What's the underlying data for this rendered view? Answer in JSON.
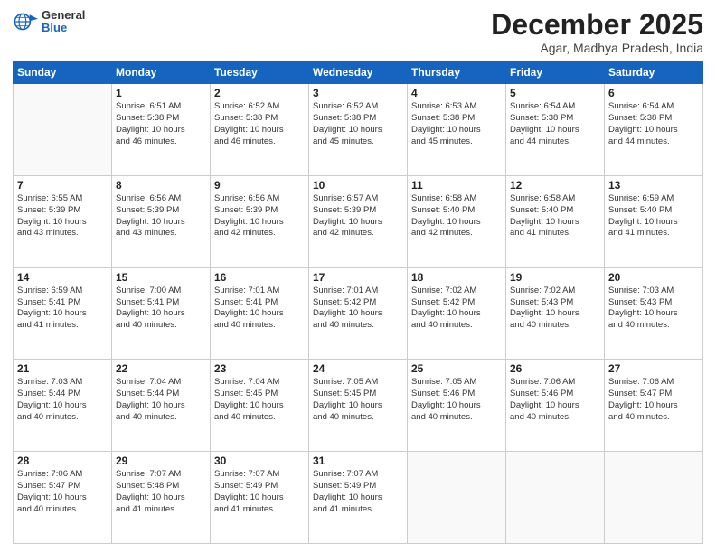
{
  "header": {
    "logo_general": "General",
    "logo_blue": "Blue",
    "month_title": "December 2025",
    "subtitle": "Agar, Madhya Pradesh, India"
  },
  "weekdays": [
    "Sunday",
    "Monday",
    "Tuesday",
    "Wednesday",
    "Thursday",
    "Friday",
    "Saturday"
  ],
  "weeks": [
    [
      {
        "day": "",
        "info": ""
      },
      {
        "day": "1",
        "info": "Sunrise: 6:51 AM\nSunset: 5:38 PM\nDaylight: 10 hours\nand 46 minutes."
      },
      {
        "day": "2",
        "info": "Sunrise: 6:52 AM\nSunset: 5:38 PM\nDaylight: 10 hours\nand 46 minutes."
      },
      {
        "day": "3",
        "info": "Sunrise: 6:52 AM\nSunset: 5:38 PM\nDaylight: 10 hours\nand 45 minutes."
      },
      {
        "day": "4",
        "info": "Sunrise: 6:53 AM\nSunset: 5:38 PM\nDaylight: 10 hours\nand 45 minutes."
      },
      {
        "day": "5",
        "info": "Sunrise: 6:54 AM\nSunset: 5:38 PM\nDaylight: 10 hours\nand 44 minutes."
      },
      {
        "day": "6",
        "info": "Sunrise: 6:54 AM\nSunset: 5:38 PM\nDaylight: 10 hours\nand 44 minutes."
      }
    ],
    [
      {
        "day": "7",
        "info": "Sunrise: 6:55 AM\nSunset: 5:39 PM\nDaylight: 10 hours\nand 43 minutes."
      },
      {
        "day": "8",
        "info": "Sunrise: 6:56 AM\nSunset: 5:39 PM\nDaylight: 10 hours\nand 43 minutes."
      },
      {
        "day": "9",
        "info": "Sunrise: 6:56 AM\nSunset: 5:39 PM\nDaylight: 10 hours\nand 42 minutes."
      },
      {
        "day": "10",
        "info": "Sunrise: 6:57 AM\nSunset: 5:39 PM\nDaylight: 10 hours\nand 42 minutes."
      },
      {
        "day": "11",
        "info": "Sunrise: 6:58 AM\nSunset: 5:40 PM\nDaylight: 10 hours\nand 42 minutes."
      },
      {
        "day": "12",
        "info": "Sunrise: 6:58 AM\nSunset: 5:40 PM\nDaylight: 10 hours\nand 41 minutes."
      },
      {
        "day": "13",
        "info": "Sunrise: 6:59 AM\nSunset: 5:40 PM\nDaylight: 10 hours\nand 41 minutes."
      }
    ],
    [
      {
        "day": "14",
        "info": "Sunrise: 6:59 AM\nSunset: 5:41 PM\nDaylight: 10 hours\nand 41 minutes."
      },
      {
        "day": "15",
        "info": "Sunrise: 7:00 AM\nSunset: 5:41 PM\nDaylight: 10 hours\nand 40 minutes."
      },
      {
        "day": "16",
        "info": "Sunrise: 7:01 AM\nSunset: 5:41 PM\nDaylight: 10 hours\nand 40 minutes."
      },
      {
        "day": "17",
        "info": "Sunrise: 7:01 AM\nSunset: 5:42 PM\nDaylight: 10 hours\nand 40 minutes."
      },
      {
        "day": "18",
        "info": "Sunrise: 7:02 AM\nSunset: 5:42 PM\nDaylight: 10 hours\nand 40 minutes."
      },
      {
        "day": "19",
        "info": "Sunrise: 7:02 AM\nSunset: 5:43 PM\nDaylight: 10 hours\nand 40 minutes."
      },
      {
        "day": "20",
        "info": "Sunrise: 7:03 AM\nSunset: 5:43 PM\nDaylight: 10 hours\nand 40 minutes."
      }
    ],
    [
      {
        "day": "21",
        "info": "Sunrise: 7:03 AM\nSunset: 5:44 PM\nDaylight: 10 hours\nand 40 minutes."
      },
      {
        "day": "22",
        "info": "Sunrise: 7:04 AM\nSunset: 5:44 PM\nDaylight: 10 hours\nand 40 minutes."
      },
      {
        "day": "23",
        "info": "Sunrise: 7:04 AM\nSunset: 5:45 PM\nDaylight: 10 hours\nand 40 minutes."
      },
      {
        "day": "24",
        "info": "Sunrise: 7:05 AM\nSunset: 5:45 PM\nDaylight: 10 hours\nand 40 minutes."
      },
      {
        "day": "25",
        "info": "Sunrise: 7:05 AM\nSunset: 5:46 PM\nDaylight: 10 hours\nand 40 minutes."
      },
      {
        "day": "26",
        "info": "Sunrise: 7:06 AM\nSunset: 5:46 PM\nDaylight: 10 hours\nand 40 minutes."
      },
      {
        "day": "27",
        "info": "Sunrise: 7:06 AM\nSunset: 5:47 PM\nDaylight: 10 hours\nand 40 minutes."
      }
    ],
    [
      {
        "day": "28",
        "info": "Sunrise: 7:06 AM\nSunset: 5:47 PM\nDaylight: 10 hours\nand 40 minutes."
      },
      {
        "day": "29",
        "info": "Sunrise: 7:07 AM\nSunset: 5:48 PM\nDaylight: 10 hours\nand 41 minutes."
      },
      {
        "day": "30",
        "info": "Sunrise: 7:07 AM\nSunset: 5:49 PM\nDaylight: 10 hours\nand 41 minutes."
      },
      {
        "day": "31",
        "info": "Sunrise: 7:07 AM\nSunset: 5:49 PM\nDaylight: 10 hours\nand 41 minutes."
      },
      {
        "day": "",
        "info": ""
      },
      {
        "day": "",
        "info": ""
      },
      {
        "day": "",
        "info": ""
      }
    ]
  ]
}
